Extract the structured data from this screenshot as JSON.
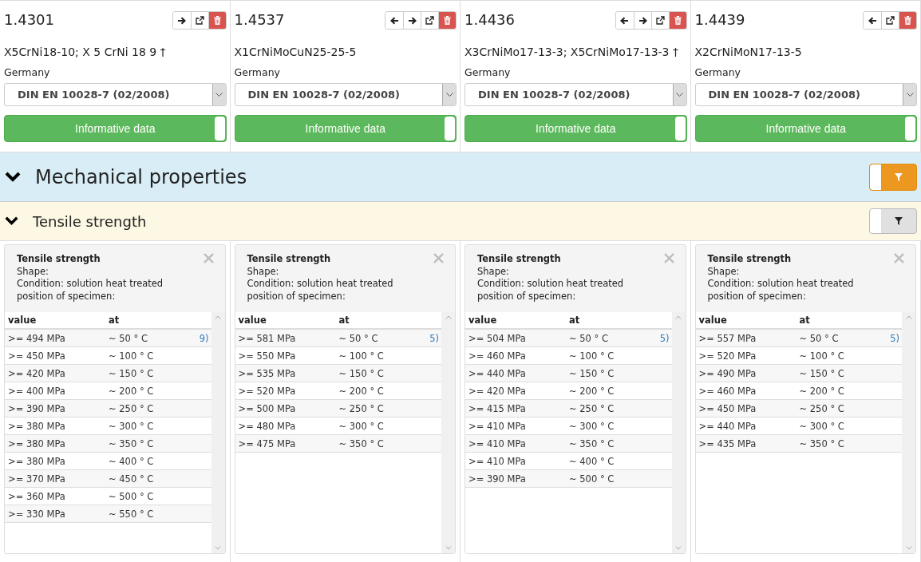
{
  "materials": [
    {
      "number": "1.4301",
      "nav": [
        {
          "kind": "next"
        },
        {
          "kind": "open"
        },
        {
          "kind": "delete"
        }
      ],
      "designation": "X5CrNi18-10; X 5 CrNi 18 9 †",
      "country": "Germany",
      "standard": "DIN EN 10028-7 (02/2008)",
      "informative": {
        "label": "Informative data",
        "on": true
      }
    },
    {
      "number": "1.4537",
      "nav": [
        {
          "kind": "prev"
        },
        {
          "kind": "next"
        },
        {
          "kind": "open"
        },
        {
          "kind": "delete"
        }
      ],
      "designation": "X1CrNiMoCuN25-25-5",
      "country": "Germany",
      "standard": "DIN EN 10028-7 (02/2008)",
      "informative": {
        "label": "Informative data",
        "on": true
      }
    },
    {
      "number": "1.4436",
      "nav": [
        {
          "kind": "prev"
        },
        {
          "kind": "next"
        },
        {
          "kind": "open"
        },
        {
          "kind": "delete"
        }
      ],
      "designation": "X3CrNiMo17-13-3; X5CrNiMo17-13-3 †",
      "country": "Germany",
      "standard": "DIN EN 10028-7 (02/2008)",
      "informative": {
        "label": "Informative data",
        "on": true
      }
    },
    {
      "number": "1.4439",
      "nav": [
        {
          "kind": "prev"
        },
        {
          "kind": "open"
        },
        {
          "kind": "delete"
        }
      ],
      "designation": "X2CrNiMoN17-13-5",
      "country": "Germany",
      "standard": "DIN EN 10028-7 (02/2008)",
      "informative": {
        "label": "Informative data",
        "on": true
      }
    }
  ],
  "section": {
    "title": "Mechanical properties",
    "expanded": true,
    "filter_on": true
  },
  "subsection": {
    "title": "Tensile strength",
    "expanded": true,
    "filter_on": false
  },
  "cards": [
    {
      "title": "Tensile strength",
      "lines": [
        "Shape:",
        "Condition: solution heat treated",
        "position of specimen:"
      ],
      "columns": [
        "value",
        "at"
      ],
      "rows": [
        {
          "value": ">= 494 MPa",
          "at": "~ 50 ° C",
          "note": "9)"
        },
        {
          "value": ">= 450 MPa",
          "at": "~ 100 ° C"
        },
        {
          "value": ">= 420 MPa",
          "at": "~ 150 ° C"
        },
        {
          "value": ">= 400 MPa",
          "at": "~ 200 ° C"
        },
        {
          "value": ">= 390 MPa",
          "at": "~ 250 ° C"
        },
        {
          "value": ">= 380 MPa",
          "at": "~ 300 ° C"
        },
        {
          "value": ">= 380 MPa",
          "at": "~ 350 ° C"
        },
        {
          "value": ">= 380 MPa",
          "at": "~ 400 ° C"
        },
        {
          "value": ">= 370 MPa",
          "at": "~ 450 ° C"
        },
        {
          "value": ">= 360 MPa",
          "at": "~ 500 ° C"
        },
        {
          "value": ">= 330 MPa",
          "at": "~ 550 ° C"
        }
      ]
    },
    {
      "title": "Tensile strength",
      "lines": [
        "Shape:",
        "Condition: solution heat treated",
        "position of specimen:"
      ],
      "columns": [
        "value",
        "at"
      ],
      "rows": [
        {
          "value": ">= 581 MPa",
          "at": "~ 50 ° C",
          "note": "5)"
        },
        {
          "value": ">= 550 MPa",
          "at": "~ 100 ° C"
        },
        {
          "value": ">= 535 MPa",
          "at": "~ 150 ° C"
        },
        {
          "value": ">= 520 MPa",
          "at": "~ 200 ° C"
        },
        {
          "value": ">= 500 MPa",
          "at": "~ 250 ° C"
        },
        {
          "value": ">= 480 MPa",
          "at": "~ 300 ° C"
        },
        {
          "value": ">= 475 MPa",
          "at": "~ 350 ° C"
        }
      ]
    },
    {
      "title": "Tensile strength",
      "lines": [
        "Shape:",
        "Condition: solution heat treated",
        "position of specimen:"
      ],
      "columns": [
        "value",
        "at"
      ],
      "rows": [
        {
          "value": ">= 504 MPa",
          "at": "~ 50 ° C",
          "note": "5)"
        },
        {
          "value": ">= 460 MPa",
          "at": "~ 100 ° C"
        },
        {
          "value": ">= 440 MPa",
          "at": "~ 150 ° C"
        },
        {
          "value": ">= 420 MPa",
          "at": "~ 200 ° C"
        },
        {
          "value": ">= 415 MPa",
          "at": "~ 250 ° C"
        },
        {
          "value": ">= 410 MPa",
          "at": "~ 300 ° C"
        },
        {
          "value": ">= 410 MPa",
          "at": "~ 350 ° C"
        },
        {
          "value": ">= 410 MPa",
          "at": "~ 400 ° C"
        },
        {
          "value": ">= 390 MPa",
          "at": "~ 500 ° C"
        }
      ]
    },
    {
      "title": "Tensile strength",
      "lines": [
        "Shape:",
        "Condition: solution heat treated",
        "position of specimen:"
      ],
      "columns": [
        "value",
        "at"
      ],
      "rows": [
        {
          "value": ">= 557 MPa",
          "at": "~ 50 ° C",
          "note": "5)"
        },
        {
          "value": ">= 520 MPa",
          "at": "~ 100 ° C"
        },
        {
          "value": ">= 490 MPa",
          "at": "~ 150 ° C"
        },
        {
          "value": ">= 460 MPa",
          "at": "~ 200 ° C"
        },
        {
          "value": ">= 450 MPa",
          "at": "~ 250 ° C"
        },
        {
          "value": ">= 440 MPa",
          "at": "~ 300 ° C"
        },
        {
          "value": ">= 435 MPa",
          "at": "~ 350 ° C"
        }
      ]
    }
  ]
}
